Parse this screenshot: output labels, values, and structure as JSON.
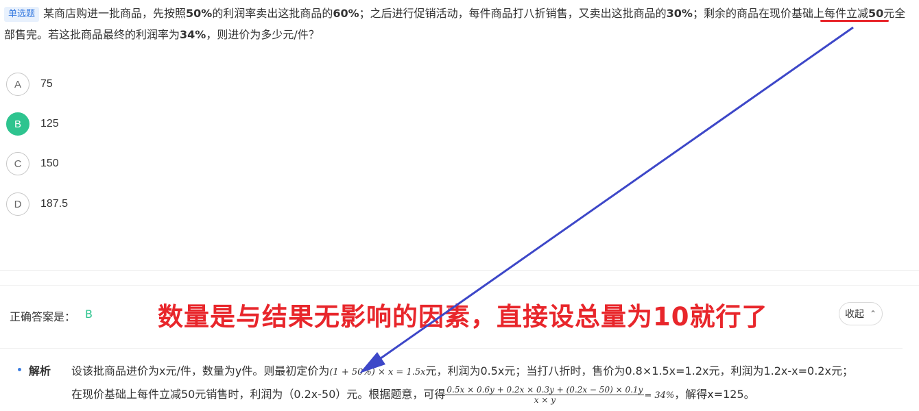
{
  "question": {
    "type_badge": "单选题",
    "t1": "某商店购进一批商品，先按照",
    "b1": "50%",
    "t2": "的利润率卖出这批商品的",
    "b2": "60%",
    "t3": "；之后进行促销活动，每件商品打八折销售，又卖出这批商品的",
    "b3": "30%",
    "t4": "；剩余的商品在现价基础上每件立减",
    "b4": "50",
    "t5": "元全部售完。若这批商品最终的利润率为",
    "b5": "34%",
    "t6": "，则进价为多少元/件？"
  },
  "options": [
    {
      "letter": "A",
      "value": "75",
      "selected": false
    },
    {
      "letter": "B",
      "value": "125",
      "selected": true
    },
    {
      "letter": "C",
      "value": "150",
      "selected": false
    },
    {
      "letter": "D",
      "value": "187.5",
      "selected": false
    }
  ],
  "answer": {
    "label": "正确答案是：",
    "value": "B"
  },
  "annotation_note": "数量是与结果无影响的因素，直接设总量为10就行了",
  "collapse_button": {
    "label": "收起",
    "icon": "chevron-up-icon"
  },
  "analysis": {
    "title": "解析",
    "p1": "设该批商品进价为x元/件，数量为y件。则最初定价为",
    "m1": "(1 + 50%) × x = 1.5x",
    "p2": "元，利润为0.5x元；当打八折时，售价为0.8×1.5x=1.2x元，利润为1.2x-x=0.2x元；",
    "p3": "在现价基础上每件立减50元销售时，利润为（0.2x-50）元。根据题意，可得",
    "frac_num": "0.5x × 0.6y + 0.2x × 0.3y + (0.2x − 50) × 0.1y",
    "frac_den": "x × y",
    "m2": "= 34%",
    "p4": "，解得x=125。"
  },
  "colors": {
    "accent_green": "#2ec48f",
    "badge_blue": "#3b7de0",
    "annotation_red": "#e8262b",
    "arrow_blue": "#3d47c8"
  }
}
